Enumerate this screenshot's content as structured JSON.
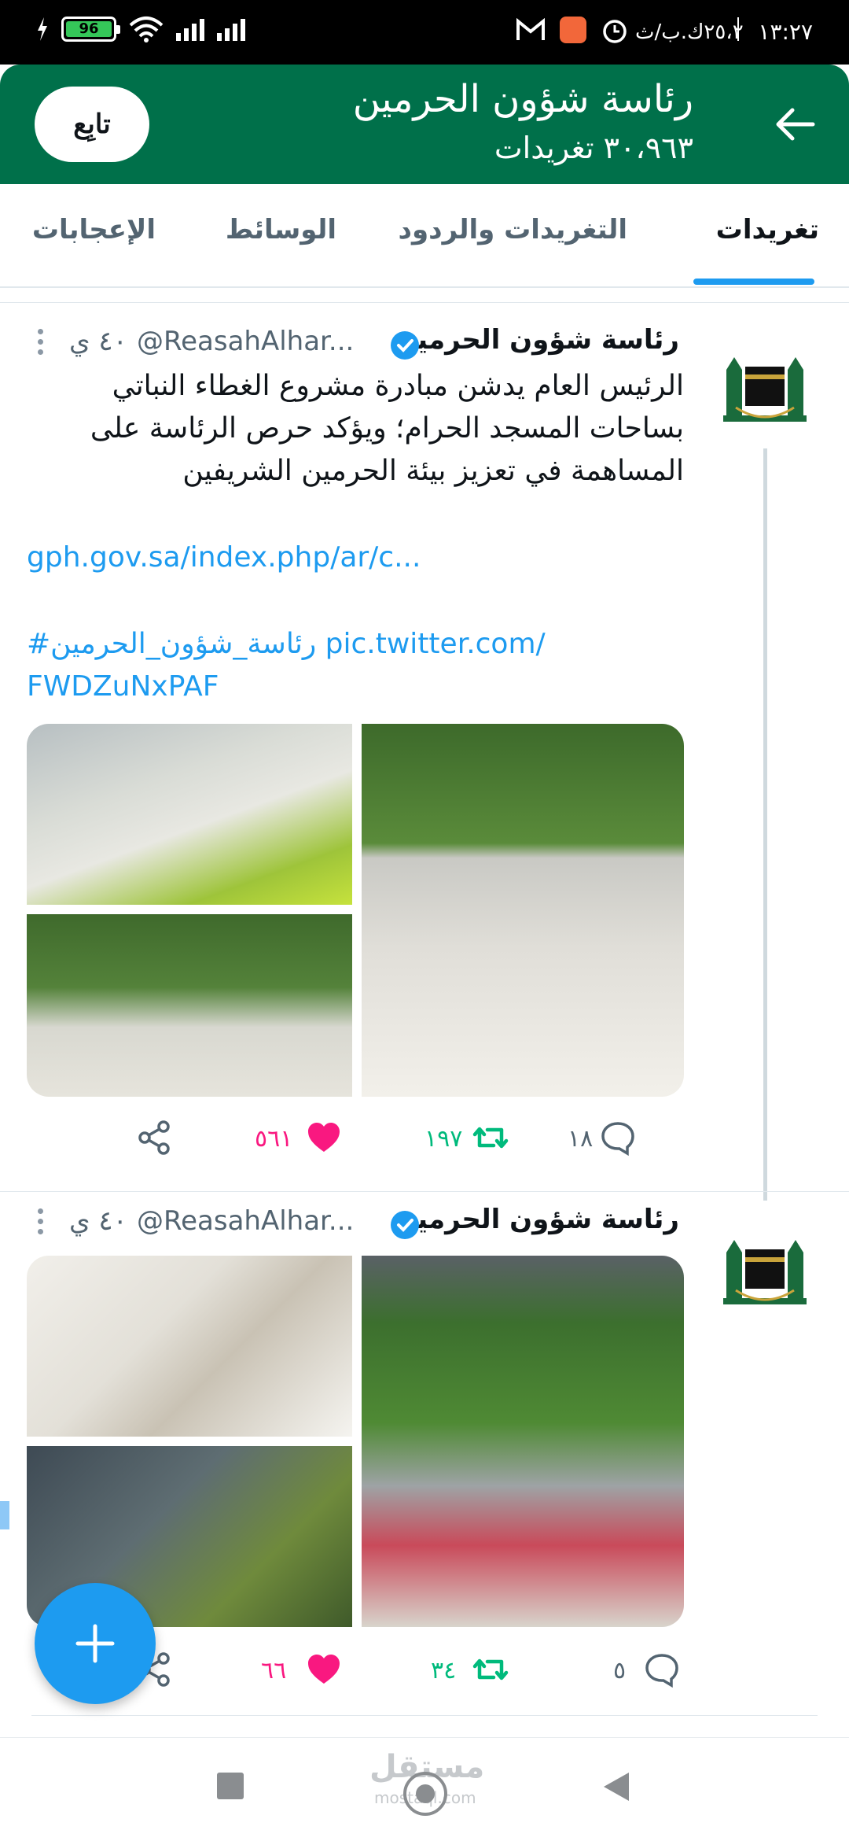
{
  "status_bar": {
    "time": "١٣:٢٧",
    "network_speed": "٢٥،٢ك.ب/ث",
    "battery": "96"
  },
  "header": {
    "title": "رئاسة شؤون الحرمين",
    "subtitle": "٣٠،٩٦٣ تغريدات",
    "follow_label": "تابِع"
  },
  "tabs": [
    {
      "label": "تغريدات",
      "active": true
    },
    {
      "label": "التغريدات والردود",
      "active": false
    },
    {
      "label": "الوسائط",
      "active": false
    },
    {
      "label": "الإعجابات",
      "active": false
    }
  ],
  "tweets": [
    {
      "author_name": "رئاسة شؤون الحرمين",
      "handle": "@ReasahAlhar...",
      "time": "٤٠ ي",
      "text": "الرئيس العام يدشن مبادرة مشروع الغطاء النباتي بساحات المسجد الحرام؛ ويؤكد حرص الرئاسة على المساهمة في تعزيز بيئة الحرمين الشريفين",
      "link": "gph.gov.sa/index.php/ar/c...",
      "hashtag_line1": "#رئاسة_شؤون_الحرمين pic.twitter.com/",
      "hashtag_line2": "FWDZuNxPAF",
      "replies": "١٨",
      "retweets": "١٩٧",
      "likes": "٥٦١"
    },
    {
      "author_name": "رئاسة شؤون الحرمين",
      "handle": "@ReasahAlhar...",
      "time": "٤٠ ي",
      "replies": "٥",
      "retweets": "٣٤",
      "likes": "٦٦"
    }
  ],
  "watermark": {
    "text": "مستقل",
    "sub": "mostaql.com"
  },
  "colors": {
    "header_green": "#00704a",
    "accent_blue": "#1d9bf0",
    "like_pink": "#f91880",
    "retweet_green": "#00ba7c"
  }
}
